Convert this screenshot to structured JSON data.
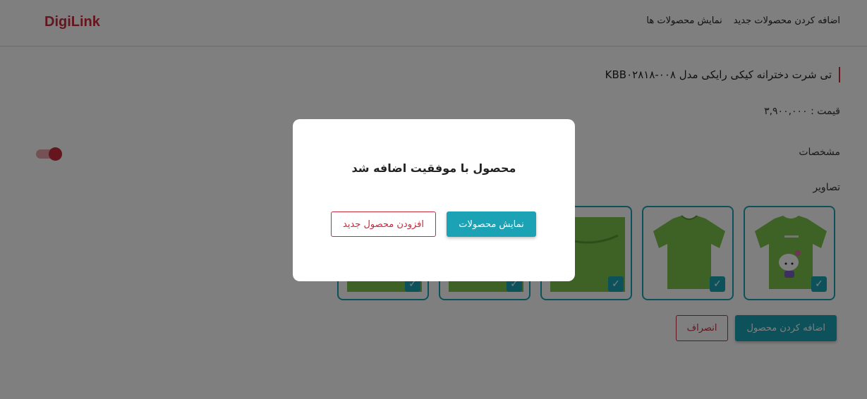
{
  "header": {
    "brand": "DigiLink",
    "nav": [
      {
        "label": "اضافه کردن محصولات جدید"
      },
      {
        "label": "نمایش محصولات ها"
      }
    ]
  },
  "product": {
    "title": "تی شرت دخترانه کیکی رایکی مدل KBB۰۲۸۱۸-۰۰۸",
    "price_label": "قیمت :",
    "price_value": "۳,۹۰۰,۰۰۰",
    "specs_label": "مشخصات",
    "specs_toggle_on": true,
    "images_label": "تصاویر",
    "images": [
      {
        "icon": "hello-kitty-shirt",
        "selected": true
      },
      {
        "icon": "plain-green-shirt",
        "selected": true
      },
      {
        "icon": "green-shirt-label",
        "selected": true
      },
      {
        "icon": "green-shirt",
        "selected": true
      },
      {
        "icon": "green-shirt",
        "selected": true
      }
    ]
  },
  "form_actions": {
    "submit_label": "اضافه کردن محصول",
    "cancel_label": "انصراف"
  },
  "modal": {
    "message": "محصول با موفقیت اضافه شد",
    "show_products_label": "نمایش محصولات",
    "add_new_label": "افزودن محصول جدید"
  },
  "colors": {
    "accent": "#1ba2b5",
    "brand": "#c82a3c",
    "shirt": "#7cc24a"
  }
}
